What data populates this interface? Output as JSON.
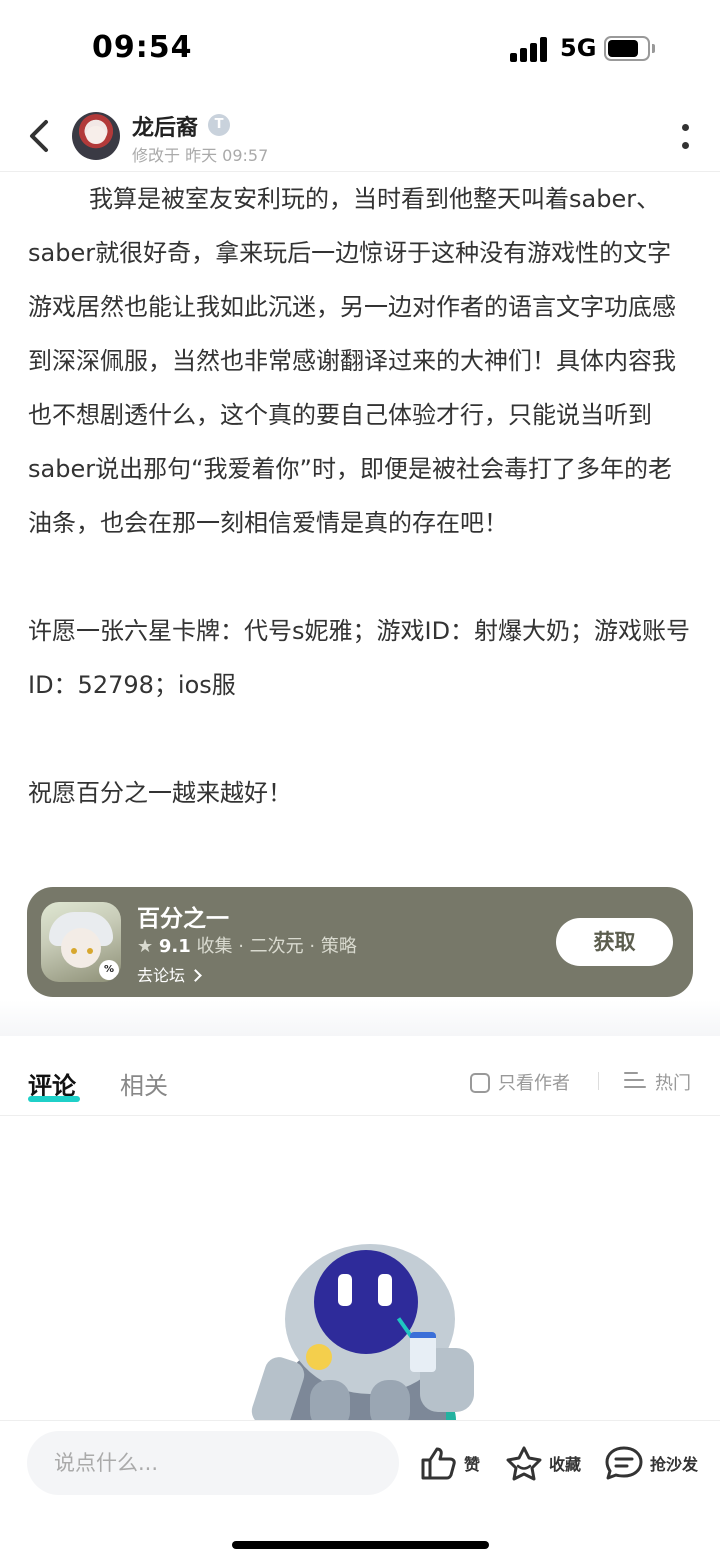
{
  "status_bar": {
    "time": "09:54",
    "network": "5G"
  },
  "header": {
    "author_name": "龙后裔",
    "author_badge": "T",
    "modified_text": "修改于 昨天 09:57"
  },
  "article": {
    "paragraphs": [
      "        我算是被室友安利玩的，当时看到他整天叫着saber、saber就很好奇，拿来玩后一边惊讶于这种没有游戏性的文字游戏居然也能让我如此沉迷，另一边对作者的语言文字功底感到深深佩服，当然也非常感谢翻译过来的大神们！具体内容我也不想剧透什么，这个真的要自己体验才行，只能说当听到saber说出那句“我爱着你”时，即便是被社会毒打了多年的老油条，也会在那一刻相信爱情是真的存在吧！",
      "许愿一张六星卡牌：代号s妮雅；游戏ID：射爆大奶；游戏账号ID：52798；ios服",
      "祝愿百分之一越来越好！"
    ]
  },
  "game_card": {
    "title": "百分之一",
    "star": "★",
    "score": "9.1",
    "tags": "收集 · 二次元 · 策略",
    "forum_link": "去论坛",
    "get_button": "获取",
    "icon_badge": "%",
    "colors": {
      "card_bg": "#777869",
      "button_text": "#5c5e4f"
    }
  },
  "tabs": {
    "comments": "评论",
    "related": "相关",
    "author_only": "只看作者",
    "sort": "热门",
    "accent_color": "#1fd0c8"
  },
  "bottom_bar": {
    "input_placeholder": "说点什么...",
    "like_label": "赞",
    "favorite_label": "收藏",
    "sofa_label": "抢沙发"
  },
  "icons": {
    "back": "chevron-left-icon",
    "more": "vertical-dots-icon",
    "like": "thumbs-up-icon",
    "favorite": "star-icon",
    "comment": "chat-bubble-icon",
    "sort": "sort-lines-icon"
  }
}
